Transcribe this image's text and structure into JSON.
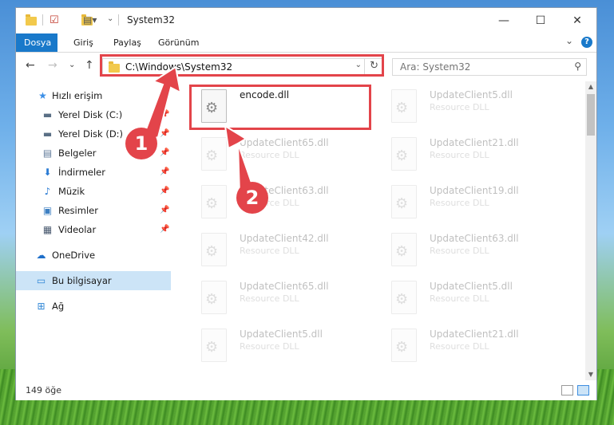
{
  "window": {
    "title": "System32",
    "minimize_glyph": "—",
    "maximize_glyph": "☐",
    "close_glyph": "✕"
  },
  "ribbon": {
    "tabs": [
      {
        "label": "Dosya",
        "active": true
      },
      {
        "label": "Giriş",
        "active": false
      },
      {
        "label": "Paylaş",
        "active": false
      },
      {
        "label": "Görünüm",
        "active": false
      }
    ],
    "expand_glyph": "⌄",
    "help_glyph": "?"
  },
  "navigation": {
    "back_glyph": "←",
    "forward_glyph": "→",
    "recent_glyph": "⌄",
    "up_glyph": "↑",
    "address_path": "C:\\Windows\\System32",
    "address_dropdown_glyph": "⌄",
    "refresh_glyph": "↻",
    "search_placeholder": "Ara: System32",
    "search_glyph": "⚲"
  },
  "sidebar": {
    "items": [
      {
        "label": "Hızlı erişim",
        "icon": "star-icon",
        "glyph": "★",
        "color": "#3a8ee6",
        "pinned": false
      },
      {
        "label": "Yerel Disk (C:)",
        "icon": "drive-icon",
        "glyph": "▬",
        "color": "#5a6f85",
        "pinned": true
      },
      {
        "label": "Yerel Disk (D:)",
        "icon": "drive-icon",
        "glyph": "▬",
        "color": "#5a6f85",
        "pinned": true
      },
      {
        "label": "Belgeler",
        "icon": "documents-icon",
        "glyph": "▤",
        "color": "#5f7a99",
        "pinned": true
      },
      {
        "label": "İndirmeler",
        "icon": "download-icon",
        "glyph": "⬇",
        "color": "#2a7bd4",
        "pinned": true
      },
      {
        "label": "Müzik",
        "icon": "music-icon",
        "glyph": "♪",
        "color": "#2a7bd4",
        "pinned": true
      },
      {
        "label": "Resimler",
        "icon": "pictures-icon",
        "glyph": "▣",
        "color": "#3d7fc2",
        "pinned": true
      },
      {
        "label": "Videolar",
        "icon": "video-icon",
        "glyph": "▦",
        "color": "#4a5a70",
        "pinned": true
      },
      {
        "label": "OneDrive",
        "icon": "cloud-icon",
        "glyph": "☁",
        "color": "#1e6fc9",
        "pinned": false
      },
      {
        "label": "Bu bilgisayar",
        "icon": "computer-icon",
        "glyph": "▭",
        "color": "#2f86d6",
        "pinned": false
      },
      {
        "label": "Ağ",
        "icon": "network-icon",
        "glyph": "⊞",
        "color": "#2f86d6",
        "pinned": false
      }
    ],
    "pin_glyph": "📌"
  },
  "files": [
    {
      "name": "encode.dll",
      "type": "",
      "highlighted": true
    },
    {
      "name": "UpdateClient5.dll",
      "type": "Resource DLL"
    },
    {
      "name": "UpdateClient65.dll",
      "type": "Resource DLL"
    },
    {
      "name": "UpdateClient21.dll",
      "type": "Resource DLL"
    },
    {
      "name": "UpdateClient63.dll",
      "type": "Resource DLL"
    },
    {
      "name": "UpdateClient19.dll",
      "type": "Resource DLL"
    },
    {
      "name": "UpdateClient42.dll",
      "type": "Resource DLL"
    },
    {
      "name": "UpdateClient63.dll",
      "type": "Resource DLL"
    },
    {
      "name": "UpdateClient65.dll",
      "type": "Resource DLL"
    },
    {
      "name": "UpdateClient5.dll",
      "type": "Resource DLL"
    },
    {
      "name": "UpdateClient5.dll",
      "type": "Resource DLL"
    },
    {
      "name": "UpdateClient21.dll",
      "type": "Resource DLL"
    }
  ],
  "status": {
    "item_count": "149 öğe"
  },
  "annotations": {
    "step1": "1",
    "step2": "2",
    "color": "#e3444a"
  },
  "scrollbar": {
    "up_glyph": "▲",
    "down_glyph": "▼"
  }
}
